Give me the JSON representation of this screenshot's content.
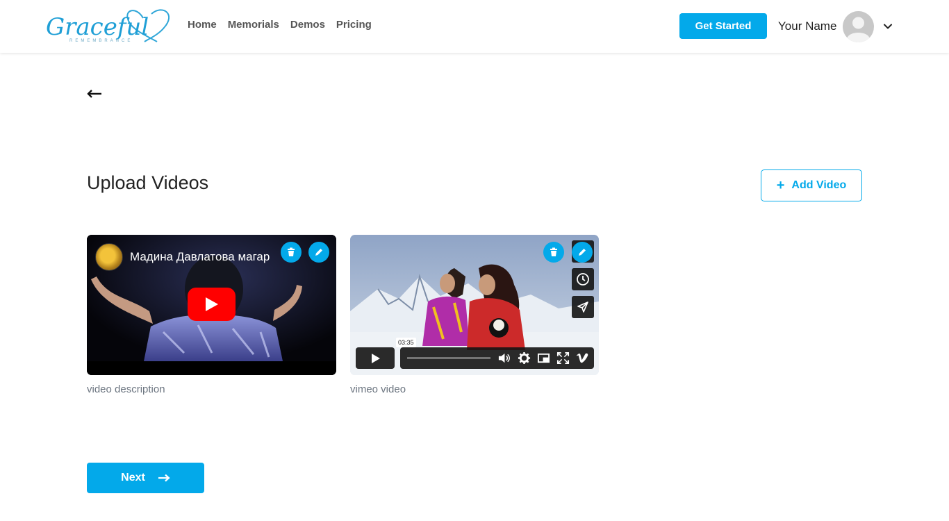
{
  "header": {
    "logo_text": "Graceful",
    "logo_subtext": "REMEMBRANCE",
    "nav": [
      {
        "label": "Home"
      },
      {
        "label": "Memorials"
      },
      {
        "label": "Demos"
      },
      {
        "label": "Pricing"
      }
    ],
    "get_started_label": "Get Started",
    "user_name": "Your Name",
    "avatar_icon": "user-avatar-icon",
    "menu_icon": "chevron-down-icon"
  },
  "back_icon": "arrow-left-icon",
  "page": {
    "title": "Upload Videos",
    "add_video_label": "Add Video"
  },
  "videos": [
    {
      "player": "youtube",
      "overlay_title": "Мадина Давлатова магар",
      "description": "video description"
    },
    {
      "player": "vimeo",
      "time_label": "03:35",
      "description": "vimeo video"
    }
  ],
  "next_label": "Next",
  "colors": {
    "accent": "#03a9ea",
    "youtube_red": "#ff0000",
    "text_muted": "#6c7580"
  }
}
